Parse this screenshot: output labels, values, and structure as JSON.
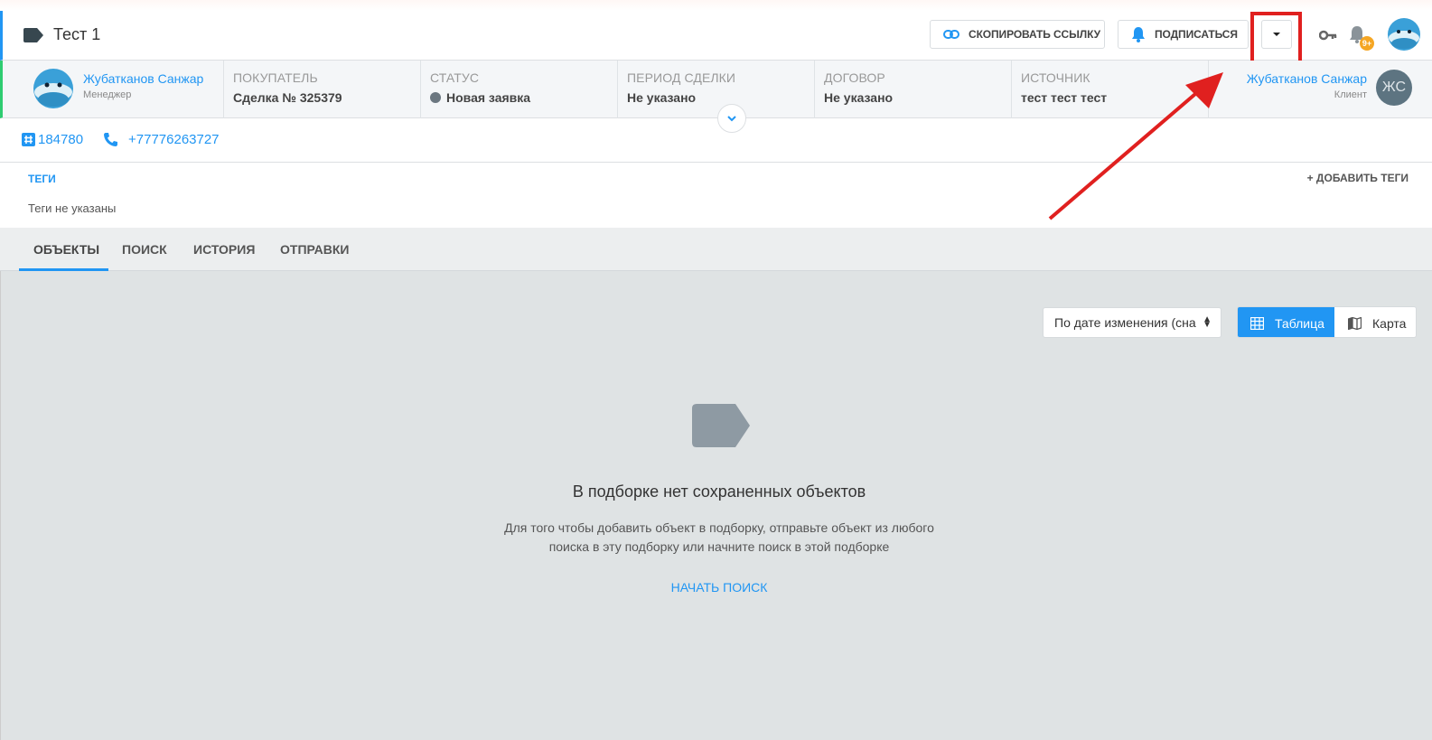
{
  "header": {
    "title": "Тест 1",
    "copy_link_label": "СКОПИРОВАТЬ ССЫЛКУ",
    "subscribe_label": "ПОДПИСАТЬСЯ",
    "notifications_badge": "9+"
  },
  "infobar": {
    "manager": {
      "name": "Жубатканов Санжар",
      "role": "Менеджер"
    },
    "fields": [
      {
        "label": "Покупатель",
        "value": "Сделка № 325379"
      },
      {
        "label": "Статус",
        "value": "Новая заявка"
      },
      {
        "label": "Период сделки",
        "value": "Не указано"
      },
      {
        "label": "Договор",
        "value": "Не указано"
      },
      {
        "label": "Источник",
        "value": "тест тест тест"
      }
    ],
    "client": {
      "name": "Жубатканов Санжар",
      "role": "Клиент",
      "initials": "ЖС"
    }
  },
  "contacts": {
    "id": "184780",
    "phone": "+77776263727"
  },
  "tags": {
    "label": "ТЕГИ",
    "add_label": "+ ДОБАВИТЬ ТЕГИ",
    "empty_text": "Теги не указаны"
  },
  "tabs": [
    {
      "label": "ОБЪЕКТЫ",
      "active": true
    },
    {
      "label": "ПОИСК",
      "active": false
    },
    {
      "label": "ИСТОРИЯ",
      "active": false
    },
    {
      "label": "ОТПРАВКИ",
      "active": false
    }
  ],
  "main": {
    "sort_value": "По дате изменения (сна",
    "view_table_label": "Таблица",
    "view_map_label": "Карта",
    "empty_title": "В подборке нет сохраненных объектов",
    "empty_description": "Для того чтобы добавить объект в подборку, отправьте объект из любого поиска в эту подборку или начните поиск в этой подборке",
    "start_search_label": "НАЧАТЬ ПОИСК"
  },
  "colors": {
    "accent": "#2196f3",
    "highlight": "#e0201f",
    "badge": "#f5a623"
  }
}
